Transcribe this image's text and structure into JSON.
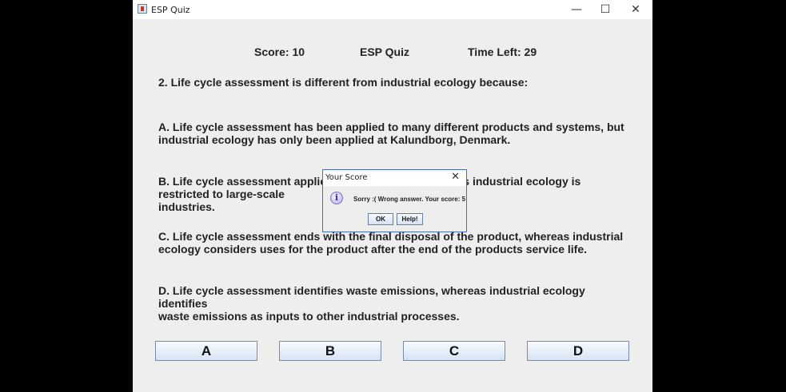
{
  "window": {
    "title": "ESP Quiz",
    "minimize_glyph": "—",
    "maximize_glyph": "☐",
    "close_glyph": "✕"
  },
  "header": {
    "score": "Score: 10",
    "title": "ESP Quiz",
    "time_left": "Time Left: 29"
  },
  "question": "2. Life cycle assessment is different from industrial ecology because:",
  "options": [
    {
      "line1": "A. Life cycle assessment has been applied to many different products and systems, but",
      "line2": "industrial ecology has only been applied at Kalundborg, Denmark."
    },
    {
      "line1": "B. Life cycle assessment applies to all industries, whereas industrial ecology is restricted to large-scale",
      "line2": "industries."
    },
    {
      "line1": "C. Life cycle assessment ends with the final disposal of the product, whereas industrial",
      "line2": "ecology considers uses for the product after the end of the products service life."
    },
    {
      "line1": "D. Life cycle assessment identifies waste emissions, whereas industrial ecology identifies",
      "line2": "waste emissions as inputs to other industrial processes."
    }
  ],
  "answer_buttons": [
    "A",
    "B",
    "C",
    "D"
  ],
  "dialog": {
    "title": "Your Score",
    "close_glyph": "✕",
    "icon_glyph": "i",
    "message": "Sorry :( Wrong answer. Your score: 5",
    "ok_label": "OK",
    "help_label": "Help!"
  }
}
